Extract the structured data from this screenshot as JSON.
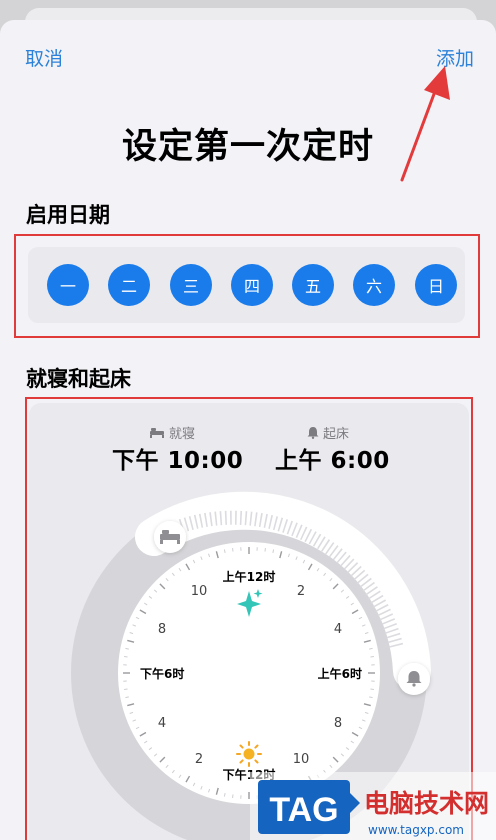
{
  "nav": {
    "cancel": "取消",
    "add": "添加"
  },
  "title": "设定第一次定时",
  "sections": {
    "days": "启用日期",
    "sleep": "就寝和起床"
  },
  "days": [
    "一",
    "二",
    "三",
    "四",
    "五",
    "六",
    "日"
  ],
  "bedtime": {
    "label": "就寝",
    "value": "下午 10:00"
  },
  "wake": {
    "label": "起床",
    "value": "上午 6:00"
  },
  "clock": {
    "top": "上午12时",
    "bottom": "下午12时",
    "left": "下午6时",
    "right": "上午6时",
    "hours": [
      "2",
      "4",
      "8",
      "10",
      "2",
      "4",
      "8",
      "10"
    ]
  },
  "watermark": {
    "logo": "TAG",
    "site_name": "电脑技术网",
    "url": "www.tagxp.com"
  },
  "colors": {
    "accent": "#1a7bea",
    "link": "#2c82d8",
    "highlight_border": "#e03a3a",
    "background": "#f2f2f7"
  }
}
